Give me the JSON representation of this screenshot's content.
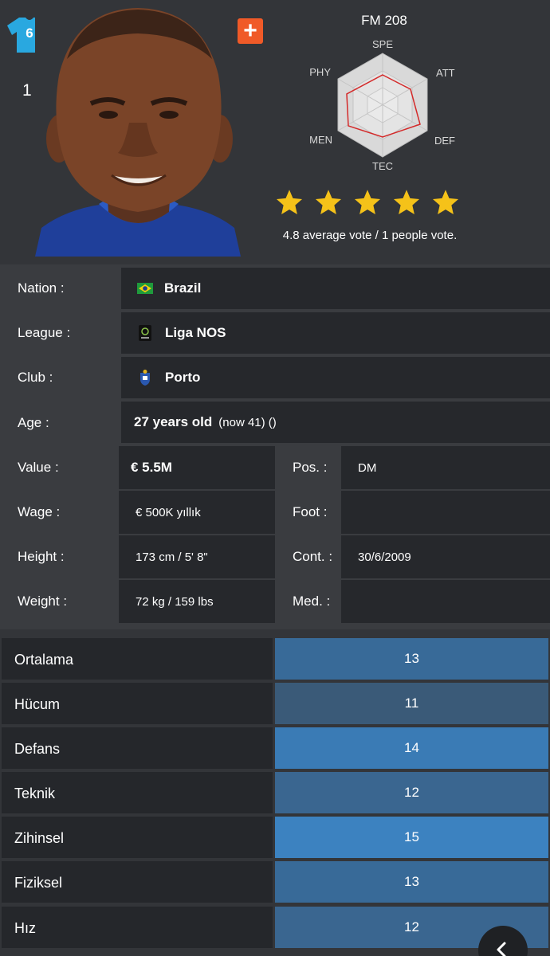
{
  "header": {
    "shirt_number": "6",
    "rank": "1",
    "fm_title": "FM 208",
    "radar_labels": {
      "spe": "SPE",
      "att": "ATT",
      "def": "DEF",
      "tec": "TEC",
      "men": "MEN",
      "phy": "PHY"
    },
    "rating_stars": 5,
    "vote_text": "4.8 average vote / 1 people vote.",
    "icons": {
      "shirt": "shirt-icon",
      "add": "plus-icon",
      "star": "star-icon",
      "back": "chevron-left-icon"
    }
  },
  "info": {
    "nation": {
      "label": "Nation :",
      "value": "Brazil"
    },
    "league": {
      "label": "League :",
      "value": "Liga NOS"
    },
    "club": {
      "label": "Club :",
      "value": "Porto"
    },
    "age": {
      "label": "Age :",
      "value": "27 years old",
      "extra": "(now 41) ()"
    },
    "value": {
      "label": "Value :",
      "value": "€ 5.5M"
    },
    "wage": {
      "label": "Wage :",
      "value": "€ 500K yıllık"
    },
    "height": {
      "label": "Height :",
      "value": "173 cm / 5' 8\""
    },
    "weight": {
      "label": "Weight :",
      "value": "72 kg / 159 lbs"
    },
    "position": {
      "label": "Pos. :",
      "value": "DM"
    },
    "foot": {
      "label": "Foot :",
      "value": ""
    },
    "contract": {
      "label": "Cont. :",
      "value": "30/6/2009"
    },
    "medical": {
      "label": "Med. :",
      "value": ""
    }
  },
  "stats": [
    {
      "name": "Ortalama",
      "value": "13"
    },
    {
      "name": "Hücum",
      "value": "11"
    },
    {
      "name": "Defans",
      "value": "14"
    },
    {
      "name": "Teknik",
      "value": "12"
    },
    {
      "name": "Zihinsel",
      "value": "15"
    },
    {
      "name": "Fiziksel",
      "value": "13"
    },
    {
      "name": "Hız",
      "value": "12"
    }
  ],
  "colors": {
    "stat_11": "#3a5a78",
    "stat_12": "#3a6690",
    "stat_13": "#386a98",
    "stat_14": "#3a7bb5",
    "stat_15": "#3c82c0",
    "accent_orange": "#f05a28",
    "star_yellow": "#f5c219",
    "shirt_blue": "#29a8e0"
  }
}
